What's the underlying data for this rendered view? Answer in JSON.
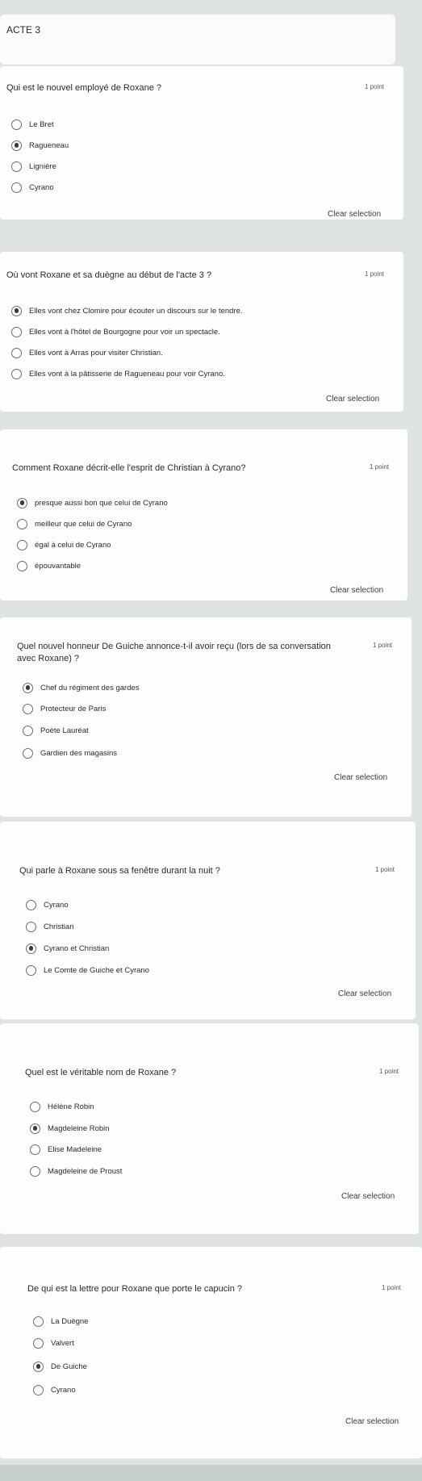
{
  "section": {
    "title": "ACTE 3"
  },
  "questions": [
    {
      "text": "Qui est le nouvel employé de Roxane ?",
      "points": "1 point",
      "options": [
        "Le Bret",
        "Ragueneau",
        "Lignière",
        "Cyrano"
      ],
      "selected": 1,
      "clear": "Clear selection"
    },
    {
      "text": "Où vont Roxane et sa duègne au début de l'acte 3 ?",
      "points": "1 point",
      "options": [
        "Elles vont chez Clomire pour écouter un discours sur le tendre.",
        "Elles vont à l'hôtel de Bourgogne pour voir un spectacle.",
        "Elles vont à Arras pour visiter Christian.",
        "Elles vont à la pâtisserie de Ragueneau pour voir Cyrano."
      ],
      "selected": 0,
      "clear": "Clear selection"
    },
    {
      "text": "Comment Roxane décrit-elle l'esprit de Christian à Cyrano?",
      "points": "1 point",
      "options": [
        "presque aussi bon que celui de Cyrano",
        "meilleur que celui de Cyrano",
        "égal à celui de Cyrano",
        "épouvantable"
      ],
      "selected": 0,
      "clear": "Clear selection"
    },
    {
      "text": "Quel nouvel honneur De Guiche annonce-t-il avoir reçu (lors de sa conversation avec Roxane) ?",
      "points": "1 point",
      "options": [
        "Chef du régiment des gardes",
        "Protecteur de Paris",
        "Poète Lauréat",
        "Gardien des magasins"
      ],
      "selected": 0,
      "clear": "Clear selection"
    },
    {
      "text": "Qui parle à Roxane sous sa fenêtre durant la nuit ?",
      "points": "1 point",
      "options": [
        "Cyrano",
        "Christian",
        "Cyrano et Christian",
        "Le Comte de Guiche et Cyrano"
      ],
      "selected": 2,
      "clear": "Clear selection"
    },
    {
      "text": "Quel est le véritable nom de Roxane ?",
      "points": "1 point",
      "options": [
        "Hélène Robin",
        "Magdeleine Robin",
        "Elise Madeleine",
        "Magdeleine de Proust"
      ],
      "selected": 1,
      "clear": "Clear selection"
    },
    {
      "text": "De qui est la lettre pour Roxane que porte le capucin ?",
      "points": "1 point",
      "options": [
        "La Duègne",
        "Valvert",
        "De Guiche",
        "Cyrano"
      ],
      "selected": 2,
      "clear": "Clear selection"
    }
  ]
}
